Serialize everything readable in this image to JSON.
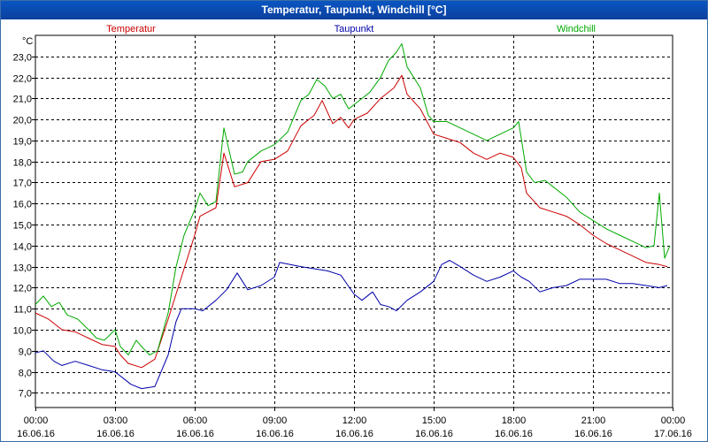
{
  "window": {
    "title": "Temperatur, Taupunkt, Windchill [°C]"
  },
  "chart_data": {
    "type": "line",
    "title": "Temperatur, Taupunkt, Windchill [°C]",
    "ylabel": "°C",
    "ylim": [
      6.3,
      24.0
    ],
    "xlim": [
      0,
      24
    ],
    "grid": true,
    "y_ticks": [
      "7,0",
      "8,0",
      "9,0",
      "10,0",
      "11,0",
      "12,0",
      "13,0",
      "14,0",
      "15,0",
      "16,0",
      "17,0",
      "18,0",
      "19,0",
      "20,0",
      "21,0",
      "22,0",
      "23,0"
    ],
    "x_ticks": [
      {
        "time": "00:00",
        "date": "16.06.16"
      },
      {
        "time": "03:00",
        "date": "16.06.16"
      },
      {
        "time": "06:00",
        "date": "16.06.16"
      },
      {
        "time": "09:00",
        "date": "16.06.16"
      },
      {
        "time": "12:00",
        "date": "16.06.16"
      },
      {
        "time": "15:00",
        "date": "16.06.16"
      },
      {
        "time": "18:00",
        "date": "16.06.16"
      },
      {
        "time": "21:00",
        "date": "16.06.16"
      },
      {
        "time": "00:00",
        "date": "17.06.16"
      }
    ],
    "series": [
      {
        "name": "Temperatur",
        "color": "#cc0000",
        "points": [
          [
            0,
            10.8
          ],
          [
            0.5,
            10.5
          ],
          [
            1,
            10.0
          ],
          [
            1.5,
            9.9
          ],
          [
            2,
            9.6
          ],
          [
            2.5,
            9.3
          ],
          [
            3,
            9.2
          ],
          [
            3.2,
            8.8
          ],
          [
            3.5,
            8.4
          ],
          [
            4,
            8.2
          ],
          [
            4.5,
            8.6
          ],
          [
            5,
            10.5
          ],
          [
            5.5,
            12.5
          ],
          [
            6,
            14.5
          ],
          [
            6.2,
            15.4
          ],
          [
            6.5,
            15.6
          ],
          [
            6.8,
            15.8
          ],
          [
            7.1,
            18.4
          ],
          [
            7.5,
            16.8
          ],
          [
            8,
            17.0
          ],
          [
            8.5,
            18.0
          ],
          [
            9,
            18.1
          ],
          [
            9.5,
            18.5
          ],
          [
            10,
            19.7
          ],
          [
            10.5,
            20.2
          ],
          [
            10.8,
            20.9
          ],
          [
            11.2,
            19.8
          ],
          [
            11.5,
            20.1
          ],
          [
            11.8,
            19.6
          ],
          [
            12,
            20.0
          ],
          [
            12.5,
            20.3
          ],
          [
            13,
            21.0
          ],
          [
            13.5,
            21.5
          ],
          [
            13.8,
            22.1
          ],
          [
            14,
            21.2
          ],
          [
            14.5,
            20.5
          ],
          [
            15,
            19.3
          ],
          [
            15.5,
            19.1
          ],
          [
            16,
            18.9
          ],
          [
            16.5,
            18.4
          ],
          [
            17,
            18.1
          ],
          [
            17.5,
            18.4
          ],
          [
            18,
            18.2
          ],
          [
            18.3,
            17.7
          ],
          [
            18.5,
            16.5
          ],
          [
            19,
            15.8
          ],
          [
            19.5,
            15.6
          ],
          [
            20,
            15.4
          ],
          [
            20.5,
            15.0
          ],
          [
            21,
            14.5
          ],
          [
            21.5,
            14.1
          ],
          [
            22,
            13.8
          ],
          [
            22.5,
            13.5
          ],
          [
            23,
            13.2
          ],
          [
            23.5,
            13.1
          ],
          [
            23.8,
            13.0
          ]
        ]
      },
      {
        "name": "Taupunkt",
        "color": "#0000aa",
        "points": [
          [
            0,
            8.9
          ],
          [
            0.3,
            9.0
          ],
          [
            0.7,
            8.5
          ],
          [
            1,
            8.3
          ],
          [
            1.5,
            8.5
          ],
          [
            2,
            8.3
          ],
          [
            2.5,
            8.1
          ],
          [
            3,
            8.0
          ],
          [
            3.3,
            7.7
          ],
          [
            3.6,
            7.4
          ],
          [
            4,
            7.2
          ],
          [
            4.5,
            7.3
          ],
          [
            5,
            8.8
          ],
          [
            5.3,
            10.4
          ],
          [
            5.5,
            11.0
          ],
          [
            6,
            11.0
          ],
          [
            6.3,
            10.9
          ],
          [
            6.8,
            11.4
          ],
          [
            7.2,
            11.9
          ],
          [
            7.6,
            12.7
          ],
          [
            8,
            11.9
          ],
          [
            8.5,
            12.1
          ],
          [
            9,
            12.5
          ],
          [
            9.2,
            13.2
          ],
          [
            9.6,
            13.1
          ],
          [
            10,
            13.0
          ],
          [
            10.5,
            12.9
          ],
          [
            11,
            12.8
          ],
          [
            11.5,
            12.6
          ],
          [
            12,
            11.7
          ],
          [
            12.3,
            11.4
          ],
          [
            12.7,
            11.8
          ],
          [
            13,
            11.2
          ],
          [
            13.3,
            11.1
          ],
          [
            13.6,
            10.9
          ],
          [
            14,
            11.4
          ],
          [
            14.5,
            11.8
          ],
          [
            15,
            12.3
          ],
          [
            15.3,
            13.1
          ],
          [
            15.6,
            13.3
          ],
          [
            16,
            13.0
          ],
          [
            16.5,
            12.6
          ],
          [
            17,
            12.3
          ],
          [
            17.5,
            12.5
          ],
          [
            18,
            12.8
          ],
          [
            18.3,
            12.5
          ],
          [
            18.6,
            12.3
          ],
          [
            19,
            11.8
          ],
          [
            19.5,
            12.0
          ],
          [
            20,
            12.1
          ],
          [
            20.5,
            12.4
          ],
          [
            21,
            12.4
          ],
          [
            21.5,
            12.4
          ],
          [
            22,
            12.2
          ],
          [
            22.5,
            12.2
          ],
          [
            23,
            12.1
          ],
          [
            23.5,
            12.0
          ],
          [
            23.8,
            12.1
          ]
        ]
      },
      {
        "name": "Windchill",
        "color": "#00aa00",
        "points": [
          [
            0,
            11.2
          ],
          [
            0.3,
            11.6
          ],
          [
            0.6,
            11.1
          ],
          [
            0.9,
            11.3
          ],
          [
            1.2,
            10.7
          ],
          [
            1.6,
            10.5
          ],
          [
            2,
            10.0
          ],
          [
            2.3,
            9.6
          ],
          [
            2.6,
            9.5
          ],
          [
            3,
            10.0
          ],
          [
            3.2,
            9.2
          ],
          [
            3.5,
            8.8
          ],
          [
            3.8,
            9.5
          ],
          [
            4,
            9.2
          ],
          [
            4.3,
            8.8
          ],
          [
            4.6,
            9.0
          ],
          [
            5,
            10.8
          ],
          [
            5.3,
            13.0
          ],
          [
            5.6,
            14.5
          ],
          [
            6,
            15.7
          ],
          [
            6.2,
            16.5
          ],
          [
            6.5,
            15.9
          ],
          [
            6.8,
            16.1
          ],
          [
            7.1,
            19.6
          ],
          [
            7.5,
            17.4
          ],
          [
            7.8,
            17.5
          ],
          [
            8,
            18.0
          ],
          [
            8.5,
            18.5
          ],
          [
            9,
            18.8
          ],
          [
            9.5,
            19.4
          ],
          [
            10,
            20.9
          ],
          [
            10.3,
            21.2
          ],
          [
            10.6,
            21.9
          ],
          [
            10.9,
            21.6
          ],
          [
            11.2,
            21.0
          ],
          [
            11.5,
            21.2
          ],
          [
            11.8,
            20.5
          ],
          [
            12,
            20.7
          ],
          [
            12.3,
            21.0
          ],
          [
            12.6,
            21.3
          ],
          [
            13,
            22.0
          ],
          [
            13.3,
            22.8
          ],
          [
            13.6,
            23.2
          ],
          [
            13.8,
            23.6
          ],
          [
            14,
            22.5
          ],
          [
            14.5,
            21.5
          ],
          [
            14.8,
            20.2
          ],
          [
            15,
            19.9
          ],
          [
            15.5,
            19.9
          ],
          [
            16,
            19.6
          ],
          [
            16.5,
            19.3
          ],
          [
            17,
            19.0
          ],
          [
            17.5,
            19.3
          ],
          [
            18,
            19.6
          ],
          [
            18.2,
            19.9
          ],
          [
            18.5,
            17.5
          ],
          [
            18.8,
            17.0
          ],
          [
            19.2,
            17.1
          ],
          [
            19.5,
            16.8
          ],
          [
            20,
            16.3
          ],
          [
            20.5,
            15.6
          ],
          [
            21,
            15.2
          ],
          [
            21.5,
            14.8
          ],
          [
            22,
            14.5
          ],
          [
            22.5,
            14.2
          ],
          [
            23,
            13.9
          ],
          [
            23.3,
            14.0
          ],
          [
            23.5,
            16.5
          ],
          [
            23.7,
            13.4
          ],
          [
            23.9,
            14.0
          ]
        ]
      }
    ]
  }
}
